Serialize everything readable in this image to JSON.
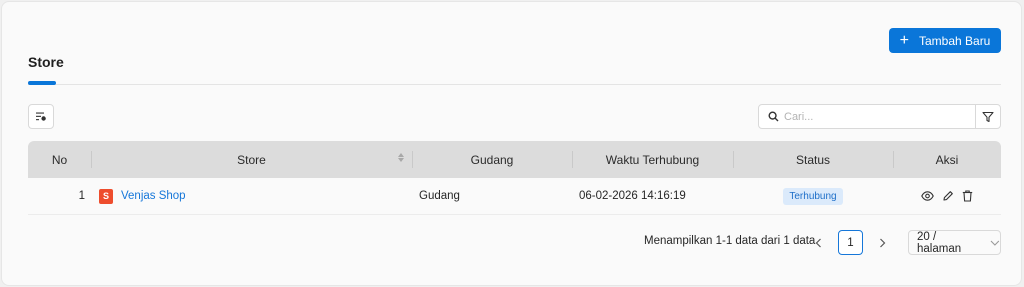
{
  "header": {
    "add_button_label": "Tambah Baru",
    "add_button_icon": "plus-icon"
  },
  "tabs": [
    {
      "label": "Store",
      "active": true
    }
  ],
  "toolbar": {
    "sort_icon": "sort-settings-icon",
    "search_placeholder": "Cari...",
    "search_value": "",
    "search_icon": "search-icon",
    "filter_icon": "filter-icon"
  },
  "table": {
    "columns": [
      "No",
      "Store",
      "Gudang",
      "Waktu Terhubung",
      "Status",
      "Aksi"
    ],
    "rows": [
      {
        "no": "1",
        "store": "Venjas Shop",
        "store_logo": "shopee-logo",
        "gudang": "Gudang",
        "waktu": "06-02-2026 14:16:19",
        "status": "Terhubung",
        "actions": [
          "view-icon",
          "edit-icon",
          "delete-icon"
        ]
      }
    ]
  },
  "pagination": {
    "info": "Menampilkan 1-1 data dari 1 data",
    "current_page": "1",
    "page_size": "20 / halaman"
  },
  "colors": {
    "accent": "#0a76d9",
    "link": "#1677d9",
    "badge_bg": "#dbeafb",
    "badge_text": "#1e6fc9",
    "shop_logo": "#ee4d2d"
  }
}
